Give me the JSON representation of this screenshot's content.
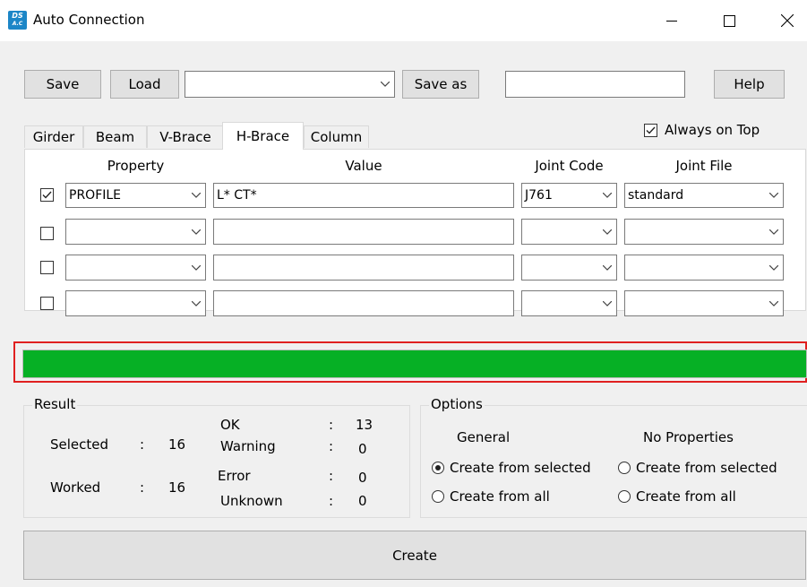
{
  "window": {
    "title": "Auto Connection",
    "icon_text_top": "DS",
    "icon_text_bottom": "A.C",
    "minimize_icon": "minimize-icon",
    "maximize_icon": "maximize-icon",
    "close_icon": "close-icon"
  },
  "toolbar": {
    "save_label": "Save",
    "load_label": "Load",
    "preset_value": "",
    "save_as_label": "Save as",
    "save_as_value": "",
    "help_label": "Help"
  },
  "always_on_top": {
    "label": "Always on Top",
    "checked": true
  },
  "tabs": [
    {
      "label": "Girder"
    },
    {
      "label": "Beam"
    },
    {
      "label": "V-Brace"
    },
    {
      "label": "H-Brace",
      "active": true
    },
    {
      "label": "Column"
    }
  ],
  "table": {
    "headers": {
      "property": "Property",
      "value": "Value",
      "joint_code": "Joint Code",
      "joint_file": "Joint File"
    },
    "rows": [
      {
        "checked": true,
        "property": "PROFILE",
        "value": "L* CT*",
        "joint_code": "J761",
        "joint_file": "standard"
      },
      {
        "checked": false,
        "property": "",
        "value": "",
        "joint_code": "",
        "joint_file": ""
      },
      {
        "checked": false,
        "property": "",
        "value": "",
        "joint_code": "",
        "joint_file": ""
      },
      {
        "checked": false,
        "property": "",
        "value": "",
        "joint_code": "",
        "joint_file": ""
      }
    ]
  },
  "progress": {
    "fraction": 1.0,
    "color": "#06b025",
    "highlight_border": "#e02020"
  },
  "result": {
    "title": "Result",
    "selected_label": "Selected",
    "selected_value": "16",
    "worked_label": "Worked",
    "worked_value": "16",
    "ok_label": "OK",
    "ok_value": "13",
    "warning_label": "Warning",
    "warning_value": "0",
    "error_label": "Error",
    "error_value": "0",
    "unknown_label": "Unknown",
    "unknown_value": "0",
    "colon": ":"
  },
  "options": {
    "title": "Options",
    "general_label": "General",
    "no_properties_label": "No Properties",
    "general_from_selected": "Create from selected",
    "general_from_all": "Create from all",
    "noprop_from_selected": "Create from selected",
    "noprop_from_all": "Create from all",
    "general_selected": "selected",
    "noprop_selected": "none"
  },
  "create_label": "Create"
}
